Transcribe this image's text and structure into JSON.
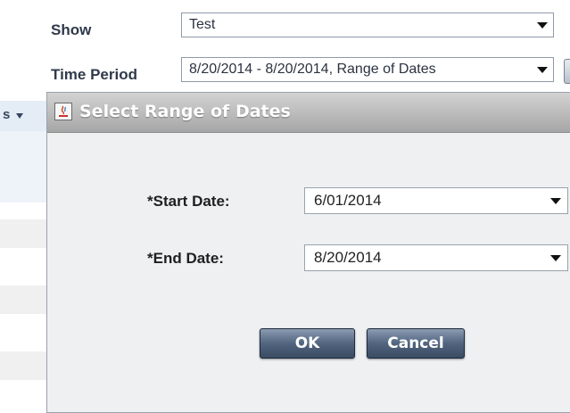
{
  "filters": {
    "show_label": "Show",
    "show_value": "Test",
    "time_period_label": "Time Period",
    "time_period_value": "8/20/2014 - 8/20/2014, Range of Dates"
  },
  "grid": {
    "header_fragment": "s"
  },
  "dialog": {
    "title": "Select Range of Dates",
    "start_date_label": "*Start Date:",
    "start_date_value": "6/01/2014",
    "end_date_label": "*End Date:",
    "end_date_value": "8/20/2014",
    "ok_label": "OK",
    "cancel_label": "Cancel"
  },
  "icons": {
    "dropdown": "chevron-down-icon",
    "app_title": "java-app-icon"
  }
}
